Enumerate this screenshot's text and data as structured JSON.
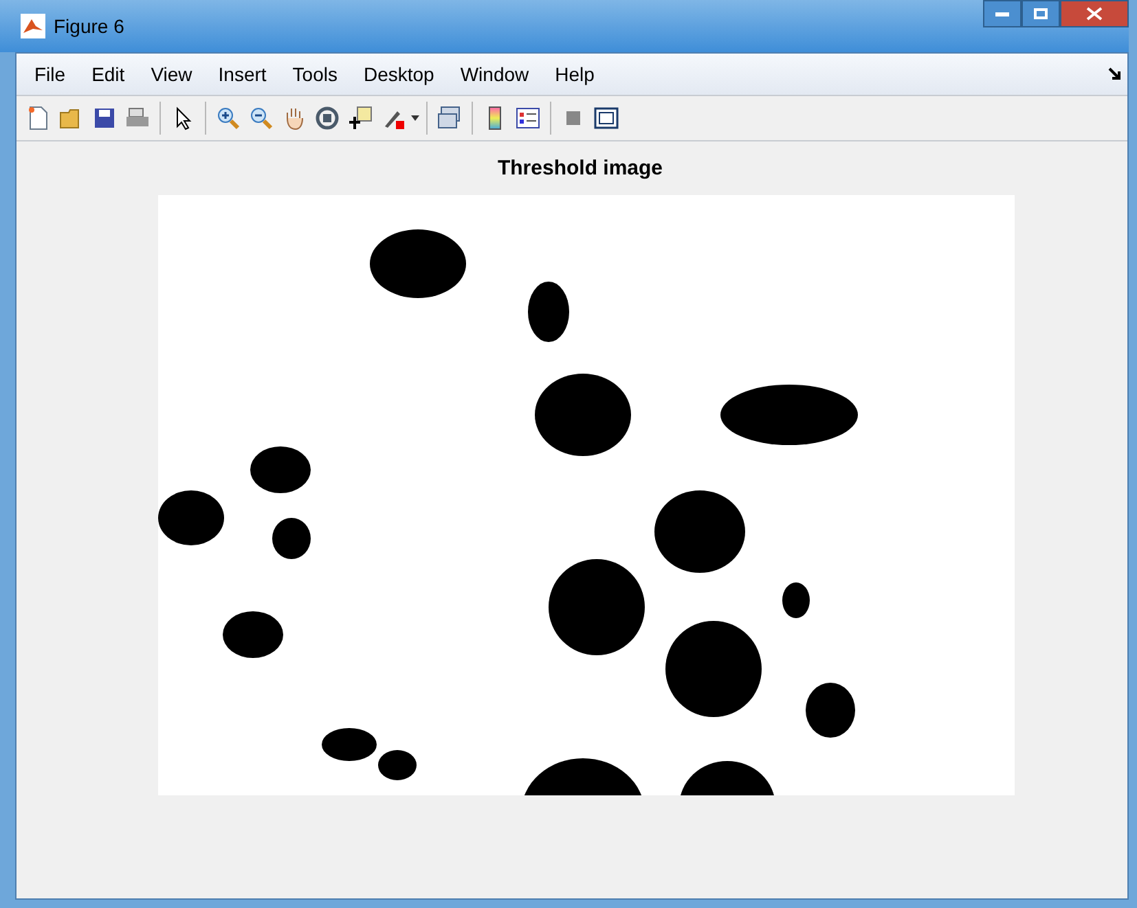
{
  "window": {
    "title": "Figure 6"
  },
  "menu": [
    "File",
    "Edit",
    "View",
    "Insert",
    "Tools",
    "Desktop",
    "Window",
    "Help"
  ],
  "figure": {
    "title": "Threshold image"
  }
}
